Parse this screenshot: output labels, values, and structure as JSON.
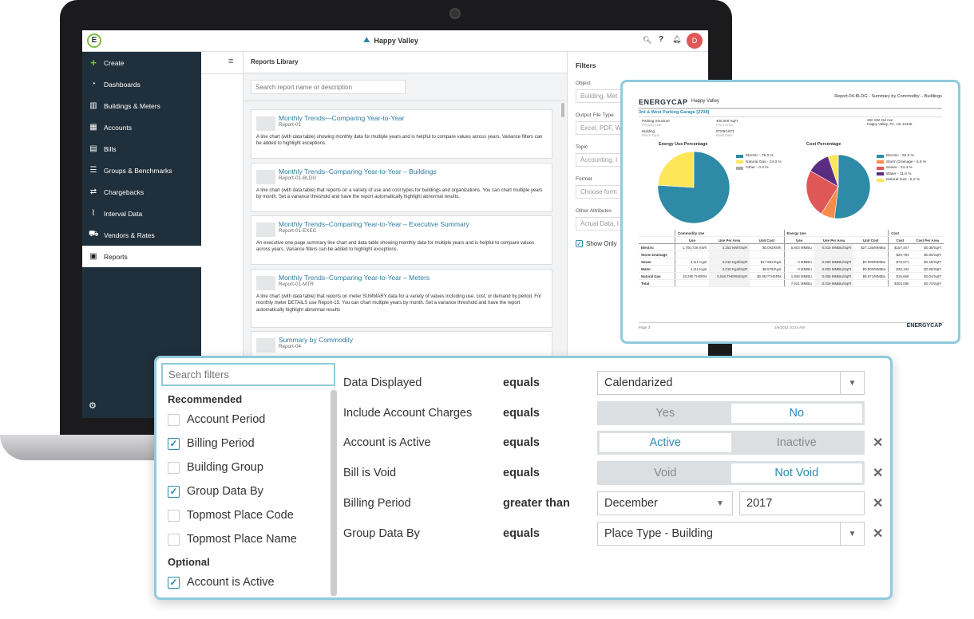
{
  "app": {
    "title": "Happy Valley",
    "avatar": "D"
  },
  "sidebar": {
    "items": [
      {
        "label": "Create",
        "icon": "plus-icon"
      },
      {
        "label": "Dashboards",
        "icon": "gauge-icon"
      },
      {
        "label": "Buildings & Meters",
        "icon": "buildings-icon"
      },
      {
        "label": "Accounts",
        "icon": "calculator-icon"
      },
      {
        "label": "Bills",
        "icon": "bill-icon"
      },
      {
        "label": "Groups & Benchmarks",
        "icon": "groups-icon"
      },
      {
        "label": "Chargebacks",
        "icon": "chargeback-icon"
      },
      {
        "label": "Interval Data",
        "icon": "chart-icon"
      },
      {
        "label": "Vendors & Rates",
        "icon": "vendor-icon"
      },
      {
        "label": "Reports",
        "icon": "reports-icon"
      }
    ]
  },
  "library": {
    "title": "Reports Library",
    "search_placeholder": "Search report name or description",
    "reports": [
      {
        "title": "Monthly Trends—Comparing Year-to-Year",
        "id": "Report-01",
        "desc": "A line chart (with data table) showing monthly data for multiple years and is helpful to compare values across years. Variance filters can be added to highlight exceptions."
      },
      {
        "title": "Monthly Trends–Comparing Year-to-Year – Buildings",
        "id": "Report-01-BLDG",
        "desc": "A line chart (with data table) that reports on a variety of use and cost types for buildings and organizations. You can chart multiple years by month. Set a variance threshold and have the report automatically highlight abnormal results."
      },
      {
        "title": "Monthly Trends–Comparing Year-to-Year – Executive Summary",
        "id": "Report-01-EXEC",
        "desc": "An executive one-page summary line chart and data table showing monthly data for multiple years and is helpful to compare values across years. Variance filters can be added to highlight exceptions."
      },
      {
        "title": "Monthly Trends–Comparing Year-to-Year – Meters",
        "id": "Report-01-MTR",
        "desc": "A line chart (with data table) that reports on meter SUMMARY data for a variety of values including use, cost, or demand by period. For monthly meter DETAILS use Report-15. You can chart multiple years by month. Set a variance threshold and have the report automatically highlight abnormal results"
      },
      {
        "title": "Summary by Commodity",
        "id": "Report-04",
        "desc": ""
      }
    ]
  },
  "filters": {
    "title": "Filters",
    "fields": [
      {
        "label": "Object",
        "placeholder": "Building, Met"
      },
      {
        "label": "Output File Type",
        "placeholder": "Excel, PDF, W"
      },
      {
        "label": "Topic",
        "placeholder": "Accounting, I"
      },
      {
        "label": "Format",
        "placeholder": "Choose form"
      },
      {
        "label": "Other Attributes",
        "placeholder": "Actual Data, I"
      }
    ],
    "show_only": "Show Only"
  },
  "report": {
    "logo": "ENERGYCAP",
    "org": "Happy Valley",
    "title": "Report-04-BLDG - Summary by Commodity – Buildings",
    "building": "3rd & West Parking Garage [2708]",
    "info": [
      [
        "Parking Structure",
        "Primary Use"
      ],
      [
        "Building",
        "Place Type"
      ],
      [
        "400,000 SqFt",
        "Floor Area"
      ],
      [
        "07/05/1973",
        "Build Date"
      ],
      [
        "260 SW 3rd Ave",
        "Happy Valley, PA, US 12345"
      ]
    ],
    "energy_title": "Energy Use Percentage",
    "cost_title": "Cost Percentage",
    "energy": [
      {
        "name": "Electric - 76.0 %",
        "value": 76.0,
        "color": "#2e8aa6"
      },
      {
        "name": "Natural Gas - 24.0 %",
        "value": 24.0,
        "color": "#fde65a"
      },
      {
        "name": "Other - 0.0 %",
        "value": 0.0,
        "color": "#aaaaaa"
      }
    ],
    "cost": [
      {
        "name": "Electric - 52.0 %",
        "value": 52.0,
        "color": "#2e8aa6"
      },
      {
        "name": "Storm Drainage - 6.9 %",
        "value": 6.9,
        "color": "#f78b4a"
      },
      {
        "name": "Sewer - 24.4 %",
        "value": 24.4,
        "color": "#e05757"
      },
      {
        "name": "Water - 11.6 %",
        "value": 11.6,
        "color": "#5b2d82"
      },
      {
        "name": "Natural Gas - 5.2 %",
        "value": 5.2,
        "color": "#fde65a"
      }
    ],
    "groups": [
      "Commodity Use",
      "Energy Use",
      "Cost"
    ],
    "headers": [
      "",
      "Use",
      "Use Per Area",
      "Unit Cost",
      "Use",
      "Use Per Area",
      "Unit Cost",
      "Cost",
      "Cost Per Area"
    ],
    "rows": [
      [
        "Electric",
        "1,700,729 KWh",
        "4.252 kWh/SqFt",
        "$0.093/kWh",
        "5,803 MMBtu",
        "0.015 MMBtu/SqFt",
        "$27.136/MMBtu",
        "$157,467",
        "$0.38/SqFt"
      ],
      [
        "Storm Drainage",
        "",
        "",
        "",
        "",
        "",
        "",
        "$20,793",
        "$0.05/SqFt"
      ],
      [
        "Sewer",
        "4,111 Kgal",
        "0.010 Kgal/SqFt",
        "$17.991/Kgal",
        "0 MMBtu",
        "0.000 MMBtu/SqFt",
        "$0.000/MMBtu",
        "$73,971",
        "$0.18/SqFt"
      ],
      [
        "Water",
        "4,111 Kgal",
        "0.010 Kgal/SqFt",
        "$8.578/Kgal",
        "0 MMBtu",
        "0.000 MMBtu/SqFt",
        "$0.000/MMBtu",
        "$35,192",
        "$0.08/SqFt"
      ],
      [
        "Natural Gas",
        "18,280 THERM",
        "0.046 THERM/SqFt",
        "$0.857/THERM",
        "1,828 MMBtu",
        "0.005 MMBtu/SqFt",
        "$8.571/MMBtu",
        "$15,668",
        "$0.04/SqFt"
      ],
      [
        "Total",
        "",
        "",
        "",
        "7,631 MMBtu",
        "0.019 MMBtu/SqFt",
        "",
        "$303,090",
        "$0.73/SqFt"
      ]
    ],
    "page": "Page 3",
    "date": "1/5/2022 10:24 AM"
  },
  "filter_panel": {
    "search_placeholder": "Search filters",
    "recommended": "Recommended",
    "optional": "Optional",
    "items": [
      {
        "label": "Account Period",
        "checked": false
      },
      {
        "label": "Billing Period",
        "checked": true
      },
      {
        "label": "Building Group",
        "checked": false
      },
      {
        "label": "Group Data By",
        "checked": true
      },
      {
        "label": "Topmost Place Code",
        "checked": false
      },
      {
        "label": "Topmost Place Name",
        "checked": false
      }
    ],
    "optional_items": [
      {
        "label": "Account is Active",
        "checked": true
      }
    ],
    "rows": [
      {
        "label": "Data Displayed",
        "op": "equals",
        "value": "Calendarized"
      },
      {
        "label": "Include Account Charges",
        "op": "equals",
        "options": [
          "Yes",
          "No"
        ],
        "selected": "No"
      },
      {
        "label": "Account is Active",
        "op": "equals",
        "options": [
          "Active",
          "Inactive"
        ],
        "selected": "Active"
      },
      {
        "label": "Bill is Void",
        "op": "equals",
        "options": [
          "Void",
          "Not Void"
        ],
        "selected": "Not Void"
      },
      {
        "label": "Billing Period",
        "op": "greater than",
        "value": "December",
        "value2": "2017"
      },
      {
        "label": "Group Data By",
        "op": "equals",
        "value": "Place Type - Building"
      }
    ]
  }
}
